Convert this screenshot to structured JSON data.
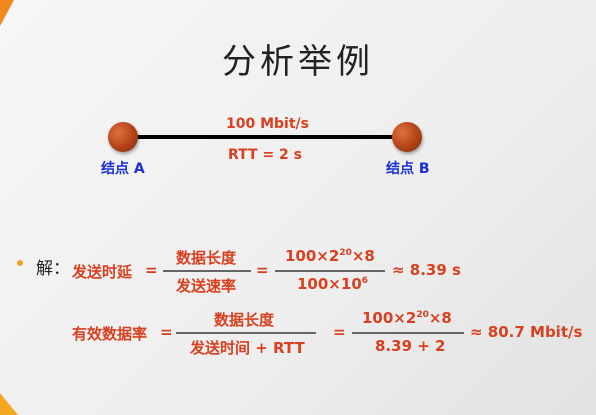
{
  "slide": {
    "title": "分析举例",
    "bandwidth": "100 Mbit/s",
    "rtt": "RTT = 2 s",
    "node_a": "结点 A",
    "node_b": "结点 B"
  },
  "solution": {
    "prefix": "解：",
    "delay_label": "发送时延",
    "eq": "=",
    "frac1_num": "数据长度",
    "frac1_den": "发送速率",
    "frac2_num_a": "100×2",
    "frac2_num_exp": "20",
    "frac2_num_b": "×8",
    "frac2_den_a": "100×10",
    "frac2_den_exp": "6",
    "result1": "≈ 8.39 s",
    "util_label": "有效数据率",
    "frac3_num": "数据长度",
    "frac3_den": "发送时间 + RTT",
    "frac4_num_a": "100×2",
    "frac4_num_exp": "20",
    "frac4_num_b": "×8",
    "frac4_den": "8.39 + 2",
    "result2": "≈ 80.7 Mbit/s"
  },
  "colors": {
    "accent": "#d9401f",
    "label_blue": "#1a2fd6",
    "node": "#b8461a",
    "decor": "#f08a1c"
  }
}
